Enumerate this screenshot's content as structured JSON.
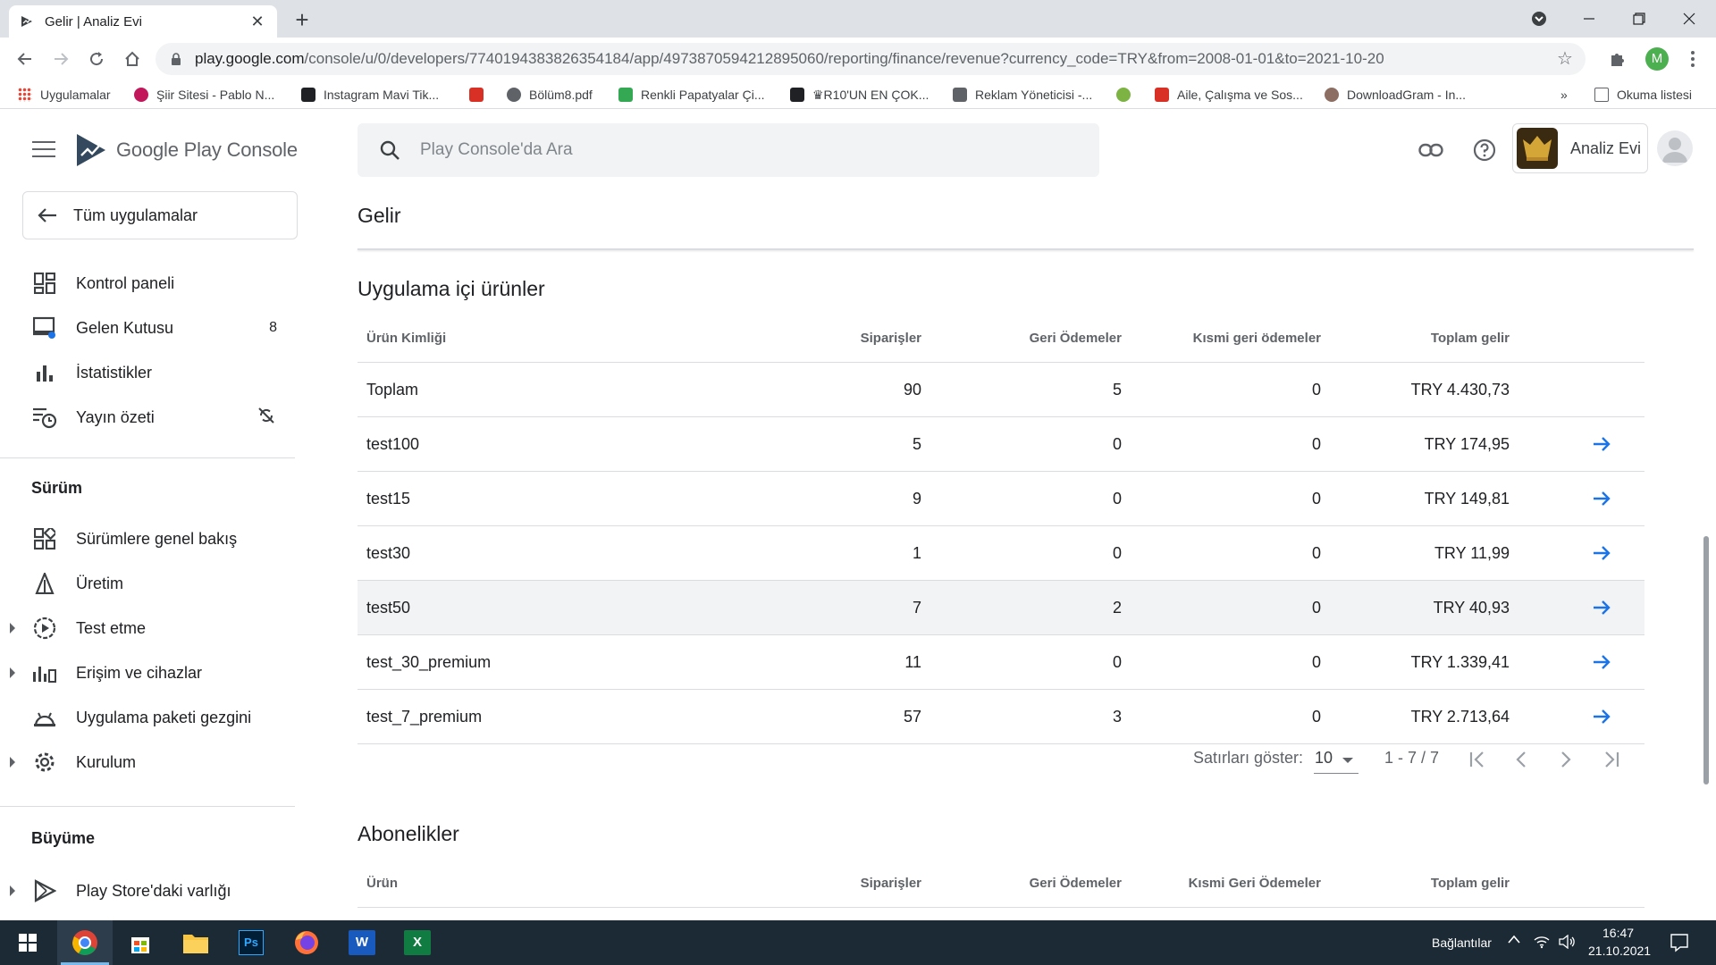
{
  "browser": {
    "tab_title": "Gelir | Analiz Evi",
    "url_host": "play.google.com",
    "url_path": "/console/u/0/developers/7740194383826354184/app/4973870594212895060/reporting/finance/revenue?currency_code=TRY&from=2008-01-01&to=2021-10-20",
    "bookmarks_overflow": "»",
    "reading_list": "Okuma listesi",
    "profile_initial": "M",
    "bookmarks": [
      {
        "label": "Uygulamalar",
        "color": "#ea4335"
      },
      {
        "label": "Şiir Sitesi - Pablo N...",
        "color": "#c2185b"
      },
      {
        "label": "Instagram Mavi Tik...",
        "color": "#202124"
      },
      {
        "label": "",
        "color": "#d93025"
      },
      {
        "label": "Bölüm8.pdf",
        "color": "#5f6368"
      },
      {
        "label": "Renkli Papatyalar Çi...",
        "color": "#34a853"
      },
      {
        "label": "♛R10'UN EN ÇOK...",
        "color": "#202124"
      },
      {
        "label": "Reklam Yöneticisi -...",
        "color": "#5f6368"
      },
      {
        "label": "",
        "color": "#7cb342"
      },
      {
        "label": "Aile, Çalışma ve Sos...",
        "color": "#d93025"
      },
      {
        "label": "DownloadGram - In...",
        "color": "#8d6e63"
      }
    ]
  },
  "console": {
    "logo_text": "Google Play Console",
    "search_placeholder": "Play Console'da Ara",
    "account_name": "Analiz Evi"
  },
  "sidebar": {
    "back_label": "Tüm uygulamalar",
    "items_top": [
      {
        "label": "Kontrol paneli",
        "icon": "dashboard-icon",
        "badge": ""
      },
      {
        "label": "Gelen Kutusu",
        "icon": "inbox-icon",
        "badge": "8"
      },
      {
        "label": "İstatistikler",
        "icon": "bar-chart-icon",
        "badge": ""
      },
      {
        "label": "Yayın özeti",
        "icon": "publishing-overview-icon",
        "badge": ""
      }
    ],
    "section_release": "Sürüm",
    "items_release": [
      {
        "label": "Sürümlere genel bakış",
        "icon": "releases-overview-icon",
        "expandable": false
      },
      {
        "label": "Üretim",
        "icon": "production-icon",
        "expandable": false
      },
      {
        "label": "Test etme",
        "icon": "testing-icon",
        "expandable": true
      },
      {
        "label": "Erişim ve cihazlar",
        "icon": "reach-devices-icon",
        "expandable": true
      },
      {
        "label": "Uygulama paketi gezgini",
        "icon": "app-bundle-explorer-icon",
        "expandable": false
      },
      {
        "label": "Kurulum",
        "icon": "setup-gear-icon",
        "expandable": true
      }
    ],
    "section_growth": "Büyüme",
    "items_growth": [
      {
        "label": "Play Store'daki varlığı",
        "icon": "play-store-presence-icon",
        "expandable": true
      }
    ]
  },
  "main": {
    "page_title": "Gelir",
    "inapp": {
      "heading": "Uygulama içi ürünler",
      "columns": [
        "Ürün Kimliği",
        "Siparişler",
        "Geri Ödemeler",
        "Kısmi geri ödemeler",
        "Toplam gelir"
      ],
      "rows": [
        {
          "id": "Toplam",
          "orders": "90",
          "refunds": "5",
          "partial": "0",
          "revenue": "TRY 4.430,73",
          "link": false
        },
        {
          "id": "test100",
          "orders": "5",
          "refunds": "0",
          "partial": "0",
          "revenue": "TRY 174,95",
          "link": true
        },
        {
          "id": "test15",
          "orders": "9",
          "refunds": "0",
          "partial": "0",
          "revenue": "TRY 149,81",
          "link": true
        },
        {
          "id": "test30",
          "orders": "1",
          "refunds": "0",
          "partial": "0",
          "revenue": "TRY 11,99",
          "link": true
        },
        {
          "id": "test50",
          "orders": "7",
          "refunds": "2",
          "partial": "0",
          "revenue": "TRY 40,93",
          "link": true
        },
        {
          "id": "test_30_premium",
          "orders": "11",
          "refunds": "0",
          "partial": "0",
          "revenue": "TRY 1.339,41",
          "link": true
        },
        {
          "id": "test_7_premium",
          "orders": "57",
          "refunds": "3",
          "partial": "0",
          "revenue": "TRY 2.713,64",
          "link": true
        }
      ],
      "pager": {
        "rows_label": "Satırları göster:",
        "rows_value": "10",
        "range": "1 - 7 / 7"
      }
    },
    "subscriptions": {
      "heading": "Abonelikler",
      "columns": [
        "Ürün",
        "Siparişler",
        "Geri Ödemeler",
        "Kısmi Geri Ödemeler",
        "Toplam gelir"
      ]
    }
  },
  "taskbar": {
    "links_label": "Bağlantılar",
    "time": "16:47",
    "date": "21.10.2021",
    "apps": [
      "chrome-icon",
      "store-icon",
      "file-explorer-icon",
      "photoshop-icon",
      "firefox-icon",
      "word-icon",
      "excel-icon"
    ]
  },
  "colors": {
    "accent_blue": "#1a73e8",
    "taskbar": "#1c2a36"
  }
}
